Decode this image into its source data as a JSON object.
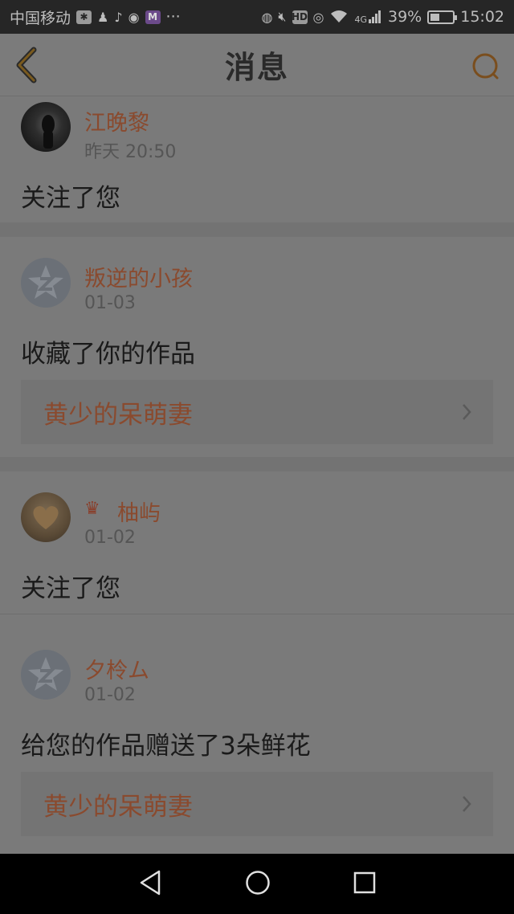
{
  "status_bar": {
    "carrier": "中国移动",
    "network": "4G",
    "battery": "39%",
    "time": "15:02",
    "more": "···",
    "hd_label": "HD",
    "m_label": "M"
  },
  "nav": {
    "title": "消息"
  },
  "messages": [
    {
      "username": "江晚黎",
      "time": "昨天 20:50",
      "action": "关注了您",
      "avatar": "photo-dark"
    },
    {
      "username": "叛逆的小孩",
      "time": "01-03",
      "action": "收藏了你的作品",
      "avatar": "default-qzone",
      "work_title": "黄少的呆萌妻"
    },
    {
      "username": "柚屿",
      "time": "01-02",
      "action": "关注了您",
      "avatar": "photo-heart",
      "badge": "crown-icon"
    },
    {
      "username": "夕柃ム",
      "time": "01-02",
      "action": "给您的作品赠送了3朵鲜花",
      "avatar": "default-qzone",
      "work_title": "黄少的呆萌妻"
    }
  ],
  "colors": {
    "accent": "#8a4a2e",
    "overlay_bg": "#7a7a7a",
    "status_bar": "#262626",
    "nav_icon": "#7a4e1e"
  }
}
